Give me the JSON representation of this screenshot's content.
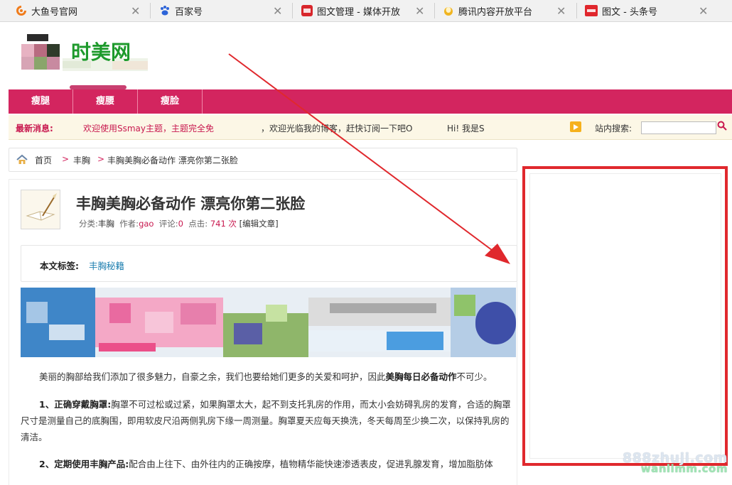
{
  "browser": {
    "tabs": [
      {
        "title": "大鱼号官网",
        "icon": "dayu-icon",
        "color": "#f07c1c"
      },
      {
        "title": "百家号",
        "icon": "baidu-paw-icon",
        "color": "#2d64d8"
      },
      {
        "title": "图文管理 - 媒体开放",
        "icon": "netease-icon",
        "color": "#d8262b"
      },
      {
        "title": "腾讯内容开放平台",
        "icon": "tencent-icon",
        "color": "#f0b420"
      },
      {
        "title": "图文 - 头条号",
        "icon": "toutiao-icon",
        "color": "#e0262c"
      }
    ]
  },
  "site": {
    "logo_text": "时美网",
    "nav": [
      "瘦腿",
      "瘦腰",
      "瘦脸"
    ],
    "news_label": "最新消息:",
    "news_items": [
      {
        "text": "欢迎使用Ssmay主题，主题完全免",
        "color": "#c8194f"
      },
      {
        "text": "，欢迎光临我的博客，赶快订阅一下吧O",
        "color": "#333333"
      },
      {
        "text": "Hi! 我是S",
        "color": "#333333"
      }
    ],
    "search_label": "站内搜索:",
    "search_placeholder": ""
  },
  "breadcrumb": {
    "home": "首页",
    "sep": ">",
    "category": "丰胸",
    "current": "丰胸美胸必备动作 漂亮你第二张脸"
  },
  "article": {
    "title": "丰胸美胸必备动作 漂亮你第二张脸",
    "meta": {
      "category_label": "分类:",
      "category": "丰胸",
      "author_label": "作者:",
      "author": "gao",
      "comments_label": "评论:",
      "comments": "0",
      "views_label": "点击:",
      "views": "741",
      "views_unit": "次",
      "edit": "[编辑文章]"
    },
    "tags_label": "本文标签:",
    "tag": "丰胸秘籍",
    "intro_pre": "美丽的胸部给我们添加了很多魅力，自豪之余，我们也要给她们更多的关爱和呵护，因此",
    "intro_bold": "美胸每日必备动作",
    "intro_post": "不可少。",
    "p1_head": "1、正确穿戴胸罩:",
    "p1_text": "胸罩不可过松或过紧，如果胸罩太大，起不到支托乳房的作用，而太小会妨碍乳房的发育，合适的胸罩尺寸是测量自己的底胸围，即用软皮尺沿两侧乳房下缘一周测量。胸罩夏天应每天换洗，冬天每周至少换二次，以保持乳房的清洁。",
    "p2_head": "2、定期使用丰胸产品:",
    "p2_text": "配合由上往下、由外往内的正确按摩，植物精华能快速渗透表皮，促进乳腺发育，增加脂肪体"
  },
  "colors": {
    "nav_bg": "#d3255f",
    "accent_red": "#e0282d",
    "news_bg": "#fcf7e6"
  },
  "watermark": {
    "line1": "888zhuji.com",
    "line2": "wanlimm.com"
  }
}
